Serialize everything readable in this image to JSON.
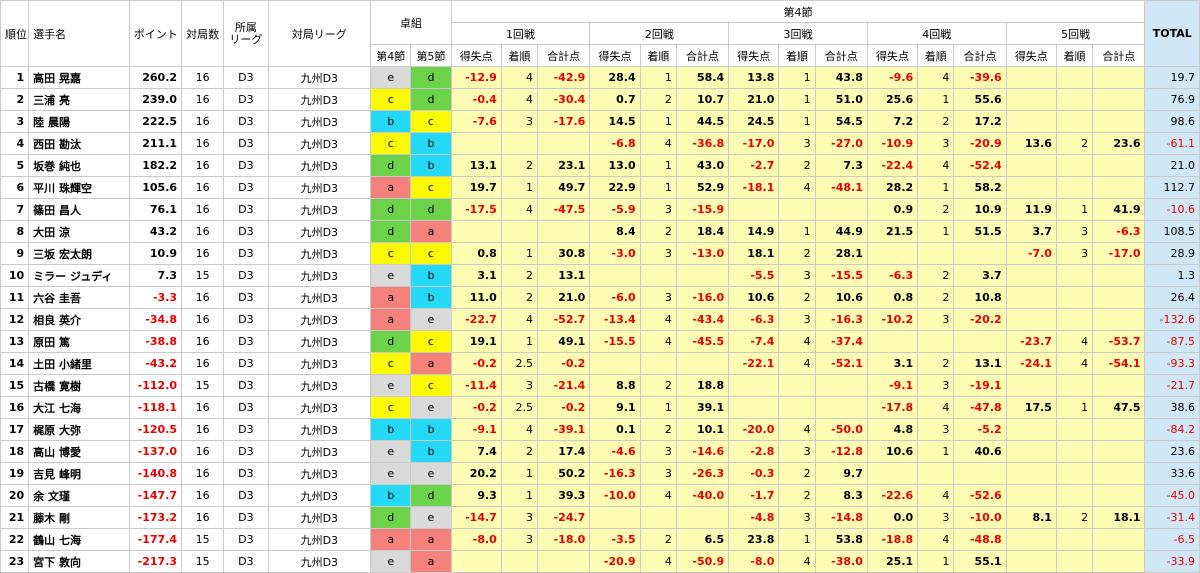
{
  "headers": {
    "rank": "順位",
    "player": "選手名",
    "points": "ポイント",
    "games": "対局数",
    "league": "所属\nリーグ",
    "match_league": "対局リーグ",
    "table_group": "卓組",
    "t4": "第4節",
    "t5": "第5節",
    "section": "第4節",
    "rounds": [
      "1回戦",
      "2回戦",
      "3回戦",
      "4回戦",
      "5回戦"
    ],
    "sub": [
      "得失点",
      "着順",
      "合計点"
    ],
    "total": "TOTAL"
  },
  "colors": {
    "a": "#f4817b",
    "b": "#23d9f5",
    "c": "#fbf903",
    "d": "#6cd24a",
    "e": "#d9d9d9",
    "pos_bg": "#fffcb4",
    "total_bg": "#cfe7f7",
    "neg": "#e00000"
  },
  "rows": [
    {
      "rank": "1",
      "name": "高田 晃嘉",
      "pts": "260.2",
      "games": "16",
      "league": "D3",
      "ml": "九州D3",
      "t4": "e",
      "t5": "d",
      "r": [
        [
          "-12.9",
          "4",
          "-42.9"
        ],
        [
          "28.4",
          "1",
          "58.4"
        ],
        [
          "13.8",
          "1",
          "43.8"
        ],
        [
          "-9.6",
          "4",
          "-39.6"
        ],
        [
          "",
          "",
          ""
        ]
      ],
      "total": "19.7"
    },
    {
      "rank": "2",
      "name": "三浦 亮",
      "pts": "239.0",
      "games": "16",
      "league": "D3",
      "ml": "九州D3",
      "t4": "c",
      "t5": "d",
      "r": [
        [
          "-0.4",
          "4",
          "-30.4"
        ],
        [
          "0.7",
          "2",
          "10.7"
        ],
        [
          "21.0",
          "1",
          "51.0"
        ],
        [
          "25.6",
          "1",
          "55.6"
        ],
        [
          "",
          "",
          ""
        ]
      ],
      "total": "76.9"
    },
    {
      "rank": "3",
      "name": "陸 晨陽",
      "pts": "222.5",
      "games": "16",
      "league": "D3",
      "ml": "九州D3",
      "t4": "b",
      "t5": "c",
      "r": [
        [
          "-7.6",
          "3",
          "-17.6"
        ],
        [
          "14.5",
          "1",
          "44.5"
        ],
        [
          "24.5",
          "1",
          "54.5"
        ],
        [
          "7.2",
          "2",
          "17.2"
        ],
        [
          "",
          "",
          ""
        ]
      ],
      "total": "98.6"
    },
    {
      "rank": "4",
      "name": "西田 勘汰",
      "pts": "211.1",
      "games": "16",
      "league": "D3",
      "ml": "九州D3",
      "t4": "c",
      "t5": "b",
      "r": [
        [
          "",
          "",
          ""
        ],
        [
          "-6.8",
          "4",
          "-36.8"
        ],
        [
          "-17.0",
          "3",
          "-27.0"
        ],
        [
          "-10.9",
          "3",
          "-20.9"
        ],
        [
          "13.6",
          "2",
          "23.6"
        ]
      ],
      "total": "-61.1"
    },
    {
      "rank": "5",
      "name": "坂巻 純也",
      "pts": "182.2",
      "games": "16",
      "league": "D3",
      "ml": "九州D3",
      "t4": "d",
      "t5": "b",
      "r": [
        [
          "13.1",
          "2",
          "23.1"
        ],
        [
          "13.0",
          "1",
          "43.0"
        ],
        [
          "-2.7",
          "2",
          "7.3"
        ],
        [
          "-22.4",
          "4",
          "-52.4"
        ],
        [
          "",
          "",
          ""
        ]
      ],
      "total": "21.0"
    },
    {
      "rank": "6",
      "name": "平川 珠輝空",
      "pts": "105.6",
      "games": "16",
      "league": "D3",
      "ml": "九州D3",
      "t4": "a",
      "t5": "c",
      "r": [
        [
          "19.7",
          "1",
          "49.7"
        ],
        [
          "22.9",
          "1",
          "52.9"
        ],
        [
          "-18.1",
          "4",
          "-48.1"
        ],
        [
          "28.2",
          "1",
          "58.2"
        ],
        [
          "",
          "",
          ""
        ]
      ],
      "total": "112.7"
    },
    {
      "rank": "7",
      "name": "篠田 昌人",
      "pts": "76.1",
      "games": "16",
      "league": "D3",
      "ml": "九州D3",
      "t4": "d",
      "t5": "d",
      "r": [
        [
          "-17.5",
          "4",
          "-47.5"
        ],
        [
          "-5.9",
          "3",
          "-15.9"
        ],
        [
          "",
          "",
          ""
        ],
        [
          "0.9",
          "2",
          "10.9"
        ],
        [
          "11.9",
          "1",
          "41.9"
        ]
      ],
      "total": "-10.6"
    },
    {
      "rank": "8",
      "name": "大田 涼",
      "pts": "43.2",
      "games": "16",
      "league": "D3",
      "ml": "九州D3",
      "t4": "d",
      "t5": "a",
      "r": [
        [
          "",
          "",
          ""
        ],
        [
          "8.4",
          "2",
          "18.4"
        ],
        [
          "14.9",
          "1",
          "44.9"
        ],
        [
          "21.5",
          "1",
          "51.5"
        ],
        [
          "3.7",
          "3",
          "-6.3"
        ]
      ],
      "total": "108.5"
    },
    {
      "rank": "9",
      "name": "三坂 宏太朗",
      "pts": "10.9",
      "games": "16",
      "league": "D3",
      "ml": "九州D3",
      "t4": "c",
      "t5": "c",
      "r": [
        [
          "0.8",
          "1",
          "30.8"
        ],
        [
          "-3.0",
          "3",
          "-13.0"
        ],
        [
          "18.1",
          "2",
          "28.1"
        ],
        [
          "",
          "",
          ""
        ],
        [
          "-7.0",
          "3",
          "-17.0"
        ]
      ],
      "total": "28.9"
    },
    {
      "rank": "10",
      "name": "ミラー ジュディ",
      "pts": "7.3",
      "games": "15",
      "league": "D3",
      "ml": "九州D3",
      "t4": "e",
      "t5": "b",
      "r": [
        [
          "3.1",
          "2",
          "13.1"
        ],
        [
          "",
          "",
          ""
        ],
        [
          "-5.5",
          "3",
          "-15.5"
        ],
        [
          "-6.3",
          "2",
          "3.7"
        ],
        [
          "",
          "",
          ""
        ]
      ],
      "total": "1.3"
    },
    {
      "rank": "11",
      "name": "六谷 圭吾",
      "pts": "-3.3",
      "games": "16",
      "league": "D3",
      "ml": "九州D3",
      "t4": "a",
      "t5": "b",
      "r": [
        [
          "11.0",
          "2",
          "21.0"
        ],
        [
          "-6.0",
          "3",
          "-16.0"
        ],
        [
          "10.6",
          "2",
          "10.6"
        ],
        [
          "0.8",
          "2",
          "10.8"
        ],
        [
          "",
          "",
          ""
        ]
      ],
      "total": "26.4"
    },
    {
      "rank": "12",
      "name": "相良 英介",
      "pts": "-34.8",
      "games": "16",
      "league": "D3",
      "ml": "九州D3",
      "t4": "a",
      "t5": "e",
      "r": [
        [
          "-22.7",
          "4",
          "-52.7"
        ],
        [
          "-13.4",
          "4",
          "-43.4"
        ],
        [
          "-6.3",
          "3",
          "-16.3"
        ],
        [
          "-10.2",
          "3",
          "-20.2"
        ],
        [
          "",
          "",
          ""
        ]
      ],
      "total": "-132.6"
    },
    {
      "rank": "13",
      "name": "原田 篤",
      "pts": "-38.8",
      "games": "16",
      "league": "D3",
      "ml": "九州D3",
      "t4": "d",
      "t5": "c",
      "r": [
        [
          "19.1",
          "1",
          "49.1"
        ],
        [
          "-15.5",
          "4",
          "-45.5"
        ],
        [
          "-7.4",
          "4",
          "-37.4"
        ],
        [
          "",
          "",
          ""
        ],
        [
          "-23.7",
          "4",
          "-53.7"
        ]
      ],
      "total": "-87.5"
    },
    {
      "rank": "14",
      "name": "土田 小緒里",
      "pts": "-43.2",
      "games": "16",
      "league": "D3",
      "ml": "九州D3",
      "t4": "c",
      "t5": "a",
      "r": [
        [
          "-0.2",
          "2.5",
          "-0.2"
        ],
        [
          "",
          "",
          ""
        ],
        [
          "-22.1",
          "4",
          "-52.1"
        ],
        [
          "3.1",
          "2",
          "13.1"
        ],
        [
          "-24.1",
          "4",
          "-54.1"
        ]
      ],
      "total": "-93.3"
    },
    {
      "rank": "15",
      "name": "古橋 寛樹",
      "pts": "-112.0",
      "games": "15",
      "league": "D3",
      "ml": "九州D3",
      "t4": "e",
      "t5": "c",
      "r": [
        [
          "-11.4",
          "3",
          "-21.4"
        ],
        [
          "8.8",
          "2",
          "18.8"
        ],
        [
          "",
          "",
          ""
        ],
        [
          "-9.1",
          "3",
          "-19.1"
        ],
        [
          "",
          "",
          ""
        ]
      ],
      "total": "-21.7"
    },
    {
      "rank": "16",
      "name": "大江 七海",
      "pts": "-118.1",
      "games": "16",
      "league": "D3",
      "ml": "九州D3",
      "t4": "c",
      "t5": "e",
      "r": [
        [
          "-0.2",
          "2.5",
          "-0.2"
        ],
        [
          "9.1",
          "1",
          "39.1"
        ],
        [
          "",
          "",
          ""
        ],
        [
          "-17.8",
          "4",
          "-47.8"
        ],
        [
          "17.5",
          "1",
          "47.5"
        ]
      ],
      "total": "38.6"
    },
    {
      "rank": "17",
      "name": "梶原 大弥",
      "pts": "-120.5",
      "games": "16",
      "league": "D3",
      "ml": "九州D3",
      "t4": "b",
      "t5": "b",
      "r": [
        [
          "-9.1",
          "4",
          "-39.1"
        ],
        [
          "0.1",
          "2",
          "10.1"
        ],
        [
          "-20.0",
          "4",
          "-50.0"
        ],
        [
          "4.8",
          "3",
          "-5.2"
        ],
        [
          "",
          "",
          ""
        ]
      ],
      "total": "-84.2"
    },
    {
      "rank": "18",
      "name": "高山 博愛",
      "pts": "-137.0",
      "games": "16",
      "league": "D3",
      "ml": "九州D3",
      "t4": "e",
      "t5": "b",
      "r": [
        [
          "7.4",
          "2",
          "17.4"
        ],
        [
          "-4.6",
          "3",
          "-14.6"
        ],
        [
          "-2.8",
          "3",
          "-12.8"
        ],
        [
          "10.6",
          "1",
          "40.6"
        ],
        [
          "",
          "",
          ""
        ]
      ],
      "total": "23.6"
    },
    {
      "rank": "19",
      "name": "吉見 峰明",
      "pts": "-140.8",
      "games": "16",
      "league": "D3",
      "ml": "九州D3",
      "t4": "e",
      "t5": "e",
      "r": [
        [
          "20.2",
          "1",
          "50.2"
        ],
        [
          "-16.3",
          "3",
          "-26.3"
        ],
        [
          "-0.3",
          "2",
          "9.7"
        ],
        [
          "",
          "",
          ""
        ],
        [
          "",
          "",
          ""
        ]
      ],
      "total": "33.6"
    },
    {
      "rank": "20",
      "name": "余 文瑾",
      "pts": "-147.7",
      "games": "16",
      "league": "D3",
      "ml": "九州D3",
      "t4": "b",
      "t5": "d",
      "r": [
        [
          "9.3",
          "1",
          "39.3"
        ],
        [
          "-10.0",
          "4",
          "-40.0"
        ],
        [
          "-1.7",
          "2",
          "8.3"
        ],
        [
          "-22.6",
          "4",
          "-52.6"
        ],
        [
          "",
          "",
          ""
        ]
      ],
      "total": "-45.0"
    },
    {
      "rank": "21",
      "name": "藤木 剛",
      "pts": "-173.2",
      "games": "16",
      "league": "D3",
      "ml": "九州D3",
      "t4": "d",
      "t5": "e",
      "r": [
        [
          "-14.7",
          "3",
          "-24.7"
        ],
        [
          "",
          "",
          ""
        ],
        [
          "-4.8",
          "3",
          "-14.8"
        ],
        [
          "0.0",
          "3",
          "-10.0"
        ],
        [
          "8.1",
          "2",
          "18.1"
        ]
      ],
      "total": "-31.4"
    },
    {
      "rank": "22",
      "name": "鶴山 七海",
      "pts": "-177.4",
      "games": "15",
      "league": "D3",
      "ml": "九州D3",
      "t4": "a",
      "t5": "a",
      "r": [
        [
          "-8.0",
          "3",
          "-18.0"
        ],
        [
          "-3.5",
          "2",
          "6.5"
        ],
        [
          "23.8",
          "1",
          "53.8"
        ],
        [
          "-18.8",
          "4",
          "-48.8"
        ],
        [
          "",
          "",
          ""
        ]
      ],
      "total": "-6.5"
    },
    {
      "rank": "23",
      "name": "宮下 敦向",
      "pts": "-217.3",
      "games": "15",
      "league": "D3",
      "ml": "九州D3",
      "t4": "e",
      "t5": "a",
      "r": [
        [
          "",
          "",
          ""
        ],
        [
          "-20.9",
          "4",
          "-50.9"
        ],
        [
          "-8.0",
          "4",
          "-38.0"
        ],
        [
          "25.1",
          "1",
          "55.1"
        ],
        [
          "",
          "",
          ""
        ]
      ],
      "total": "-33.9"
    }
  ]
}
